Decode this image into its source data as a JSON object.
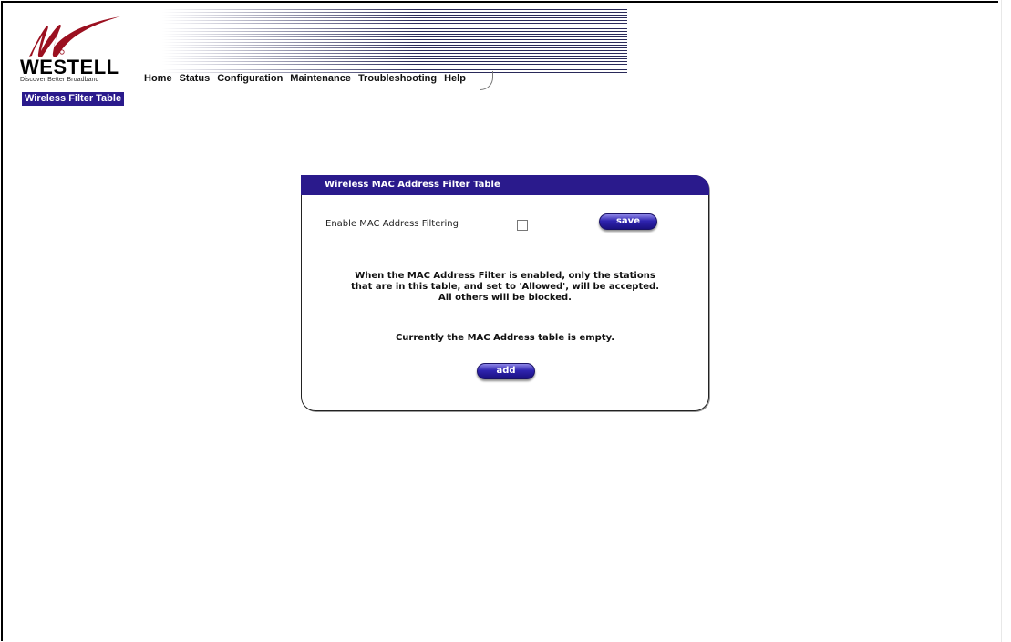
{
  "brand": {
    "name": "WESTELL",
    "tagline": "Discover  Better  Broadband"
  },
  "nav": {
    "items": [
      "Home",
      "Status",
      "Configuration",
      "Maintenance",
      "Troubleshooting",
      "Help"
    ]
  },
  "page_badge": "Wireless Filter Table",
  "panel": {
    "title": "Wireless MAC Address Filter Table",
    "enable_label": "Enable MAC Address Filtering",
    "enable_checked": false,
    "save_label": "save",
    "info_lines": [
      "When the MAC Address Filter is enabled, only the stations",
      "that are in this table, and set to 'Allowed', will be accepted.",
      "All others will be blocked."
    ],
    "empty_message": "Currently the MAC Address table is empty.",
    "add_label": "add"
  },
  "colors": {
    "accent": "#2a1a8c",
    "logo": "#9b1020"
  }
}
